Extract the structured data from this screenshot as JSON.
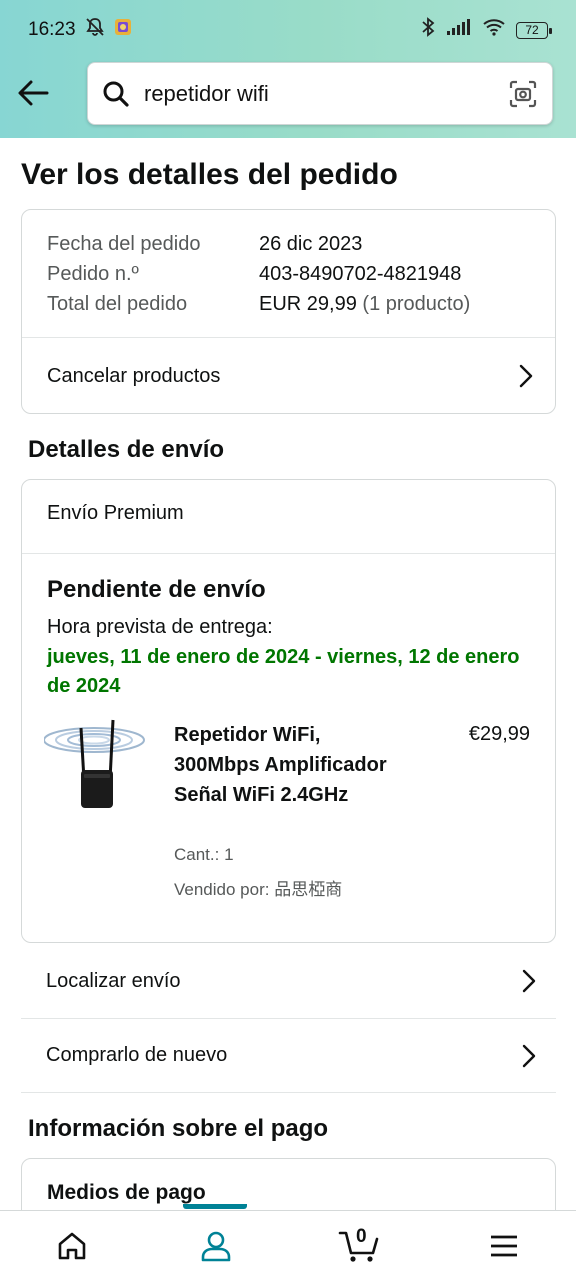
{
  "status_bar": {
    "time": "16:23",
    "battery": "72"
  },
  "search": {
    "query": "repetidor wifi"
  },
  "page": {
    "title": "Ver los detalles del pedido"
  },
  "order_summary": {
    "date_label": "Fecha del pedido",
    "date_value": "26 dic 2023",
    "number_label": "Pedido n.º",
    "number_value": "403-8490702-4821948",
    "total_label": "Total del pedido",
    "total_value": "EUR 29,99",
    "total_count": "(1 producto)",
    "cancel_label": "Cancelar productos"
  },
  "shipping": {
    "section_title": "Detalles de envío",
    "type": "Envío Premium",
    "status": "Pendiente de envío",
    "eta_label": "Hora prevista de entrega:",
    "eta_value": "jueves, 11 de enero de 2024 - viernes, 12 de enero de 2024",
    "product": {
      "title": "Repetidor WiFi, 300Mbps Amplificador Señal WiFi 2.4GHz",
      "price": "€29,99",
      "quantity": "Cant.: 1",
      "seller": "Vendido por: 品思椏商"
    },
    "track_label": "Localizar envío",
    "buy_again_label": "Comprarlo de nuevo"
  },
  "payment": {
    "section_title": "Información sobre el pago",
    "methods_label": "Medios de pago"
  },
  "bottom_nav": {
    "items": [
      "home-icon",
      "account-icon",
      "cart-icon",
      "menu-icon"
    ],
    "cart_count": "0",
    "active": "account"
  },
  "colors": {
    "accent": "#008296",
    "delivery_green": "#007600",
    "header_gradient": "#87d6d3"
  }
}
